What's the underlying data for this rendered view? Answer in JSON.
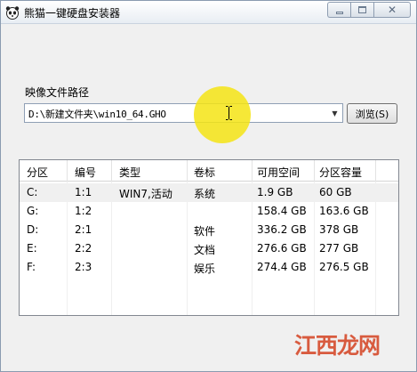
{
  "window": {
    "title": "熊猫一键硬盘安装器",
    "icon": "panda-icon"
  },
  "path_section": {
    "label": "映像文件路径",
    "value": "D:\\新建文件夹\\win10_64.GHO",
    "browse_label": "浏览(S)"
  },
  "partition_table": {
    "columns": [
      "分区",
      "编号",
      "类型",
      "卷标",
      "可用空间",
      "分区容量"
    ],
    "rows": [
      [
        "C:",
        "1:1",
        "WIN7,活动",
        "系统",
        "1.9 GB",
        "60 GB"
      ],
      [
        "G:",
        "1:2",
        "",
        "",
        "158.4 GB",
        "163.6 GB"
      ],
      [
        "D:",
        "2:1",
        "",
        "软件",
        "336.2 GB",
        "378 GB"
      ],
      [
        "E:",
        "2:2",
        "",
        "文档",
        "276.6 GB",
        "277 GB"
      ],
      [
        "F:",
        "2:3",
        "",
        "娱乐",
        "274.4 GB",
        "276.5 GB"
      ]
    ]
  },
  "watermark": {
    "text": "江西龙网"
  },
  "colors": {
    "cursor_highlight": "#f5e414",
    "watermark": "#d85b3f"
  }
}
